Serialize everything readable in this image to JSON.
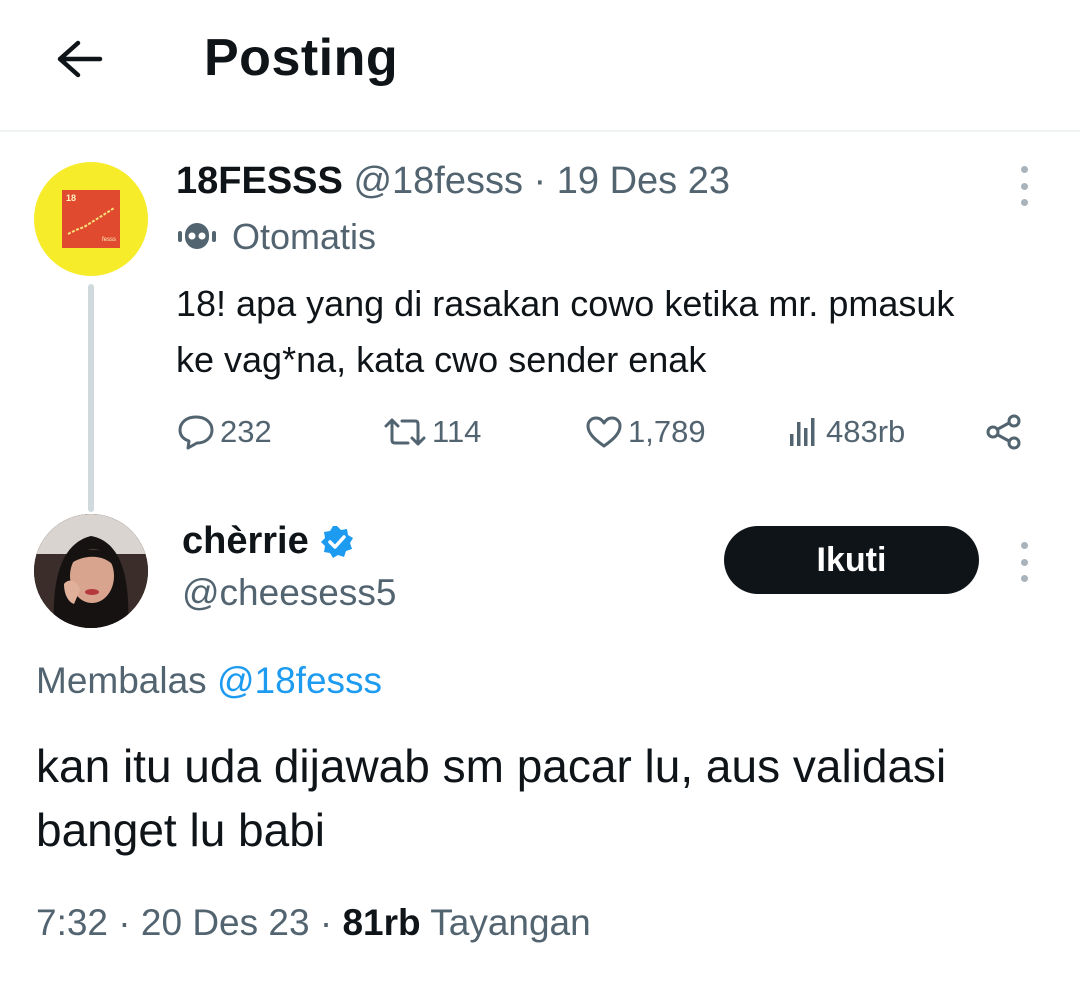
{
  "header": {
    "title": "Posting",
    "back_icon": "arrow-left-icon"
  },
  "parent_post": {
    "display_name": "18FESSS",
    "handle": "@18fesss",
    "separator": " · ",
    "date": "19 Des 23",
    "automated_label": "Otomatis",
    "text": "18! apa yang di rasakan cowo ketika mr. pmasuk ke vag*na, kata cwo sender enak",
    "avatar_colors": {
      "background": "#f6ec2a",
      "inner": "#e04a2f"
    },
    "avatar_text": {
      "top": "18",
      "bottom": "fesss"
    },
    "stats": {
      "replies": "232",
      "reposts": "114",
      "likes": "1,789",
      "views": "483rb"
    }
  },
  "reply_post": {
    "display_name": "chèrrie",
    "handle": "@cheesess5",
    "verified": true,
    "follow_label": "Ikuti",
    "replying_prefix": "Membalas",
    "replying_mention": "@18fesss",
    "text": "kan itu uda dijawab sm pacar lu, aus validasi banget lu babi",
    "time": "7:32",
    "separator": " · ",
    "date": "20 Des 23",
    "views_count": "81rb",
    "views_label": "Tayangan"
  },
  "colors": {
    "text_primary": "#0f1419",
    "text_secondary": "#536471",
    "accent": "#1d9bf0",
    "thread_line": "#cfd9de"
  }
}
